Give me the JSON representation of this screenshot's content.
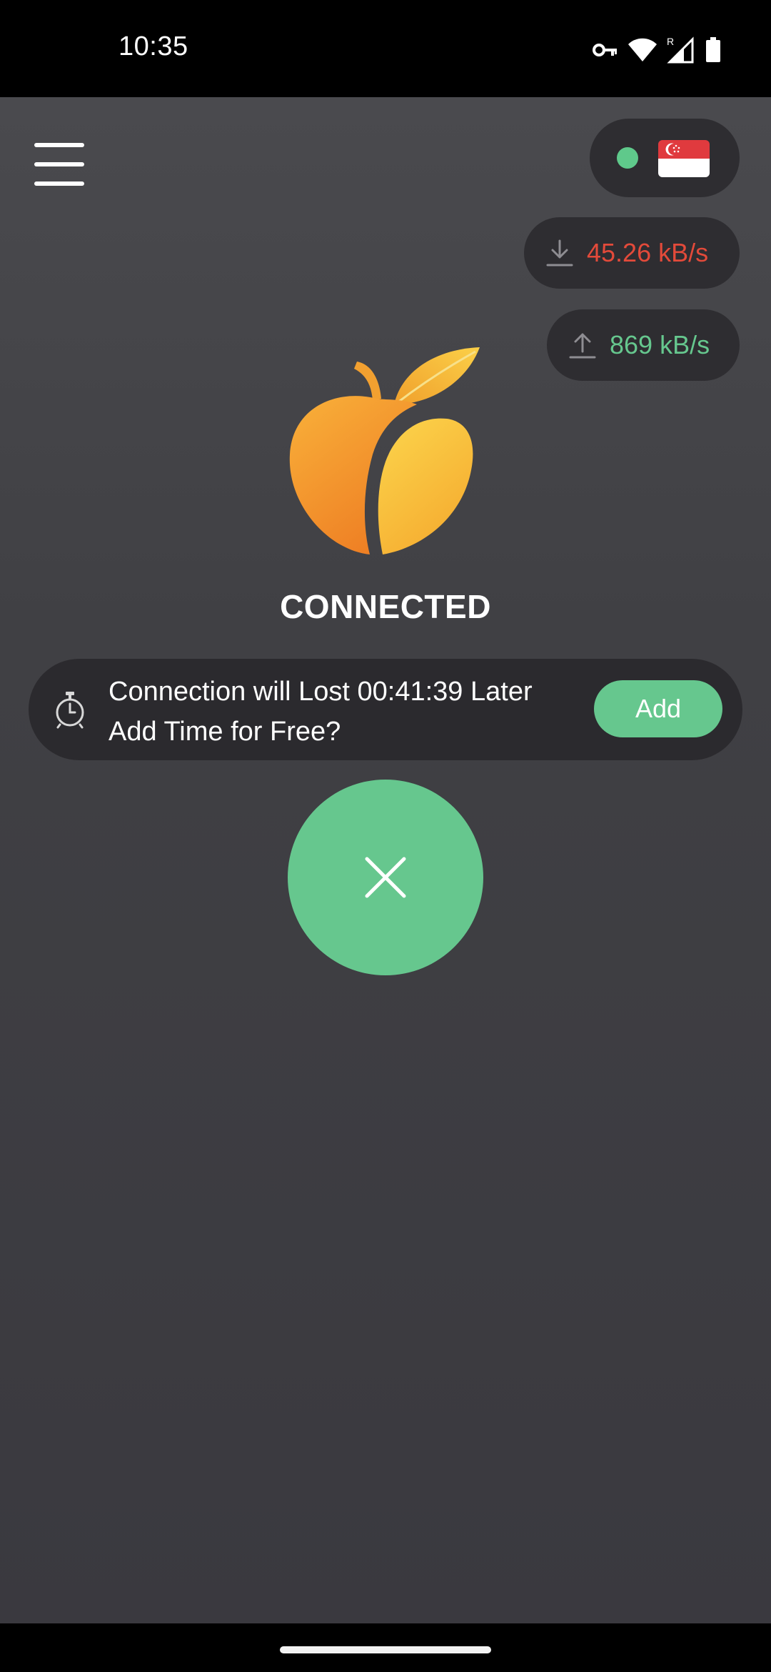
{
  "status_bar": {
    "time": "10:35",
    "icons": [
      "vpn-key-icon",
      "wifi-icon",
      "signal-icon",
      "battery-icon"
    ],
    "signal_roaming_letter": "R"
  },
  "header": {
    "menu_icon": "hamburger-menu-icon",
    "server": {
      "country_flag": "singapore-flag-icon",
      "status_color": "#5fc98b"
    }
  },
  "speeds": {
    "download": {
      "icon": "download-icon",
      "value": "45.26 kB/s",
      "color": "#e34a3a"
    },
    "upload": {
      "icon": "upload-icon",
      "value": "869 kB/s",
      "color": "#66c78e"
    }
  },
  "main": {
    "logo": "orange-fruit-logo",
    "status_text": "CONNECTED"
  },
  "timer_banner": {
    "icon": "stopwatch-icon",
    "line1": "Connection will Lost 00:41:39 Later",
    "line2": "Add Time for Free?",
    "add_button_label": "Add"
  },
  "disconnect_button": {
    "icon": "close-icon"
  },
  "colors": {
    "accent_green": "#66c78e",
    "download_red": "#e34a3a"
  }
}
